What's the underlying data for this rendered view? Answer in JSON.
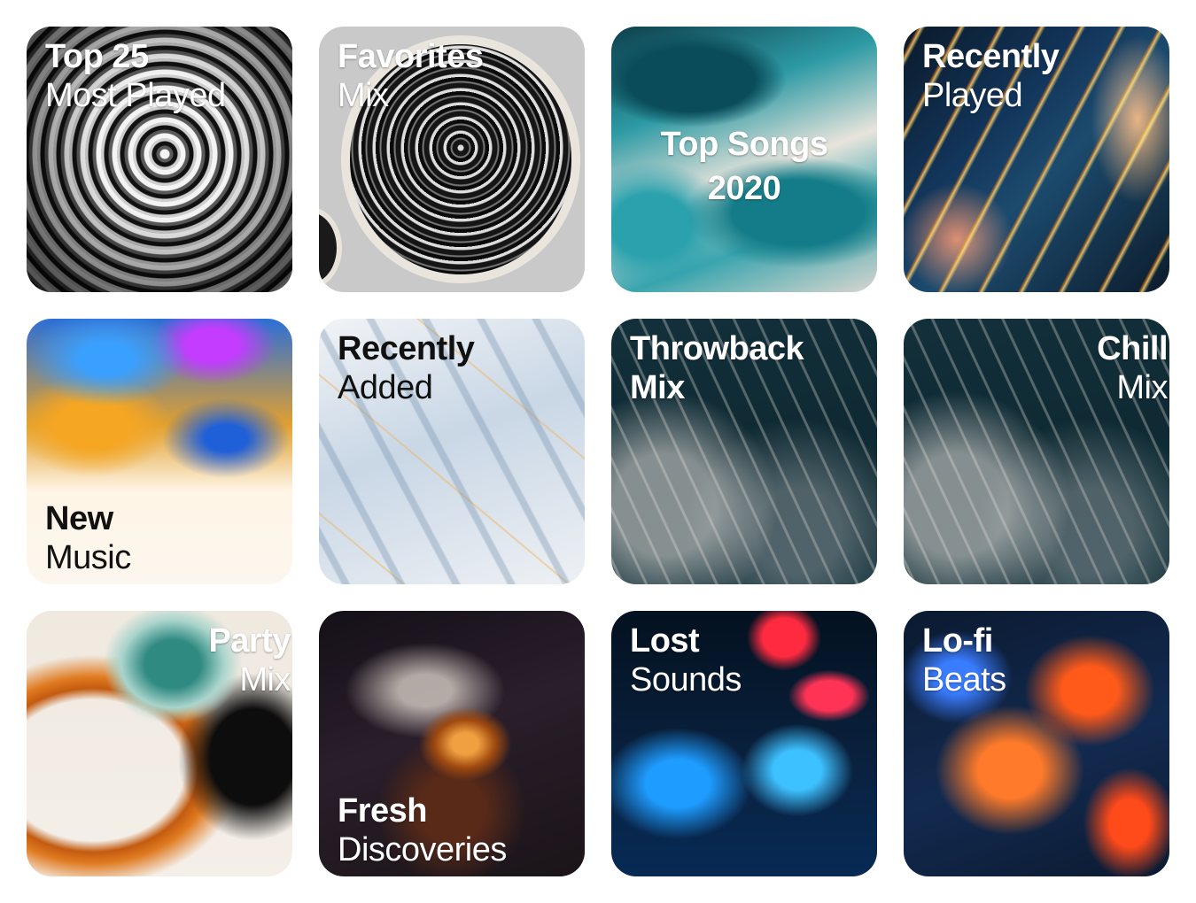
{
  "tiles": [
    {
      "line1": "Top 25",
      "line2": "Most Played"
    },
    {
      "line1": "Favorites",
      "line2": "Mix"
    },
    {
      "line1": "Top Songs",
      "line2": "2020"
    },
    {
      "line1": "Recently",
      "line2": "Played"
    },
    {
      "line1": "New",
      "line2": "Music"
    },
    {
      "line1": "Recently",
      "line2": "Added"
    },
    {
      "line1": "Throwback",
      "line2": "Mix"
    },
    {
      "line1": "Chill",
      "line2": "Mix"
    },
    {
      "line1": "Party",
      "line2": "Mix"
    },
    {
      "line1": "Fresh",
      "line2": "Discoveries"
    },
    {
      "line1": "Lost",
      "line2": "Sounds"
    },
    {
      "line1": "Lo-fi",
      "line2": "Beats"
    }
  ]
}
